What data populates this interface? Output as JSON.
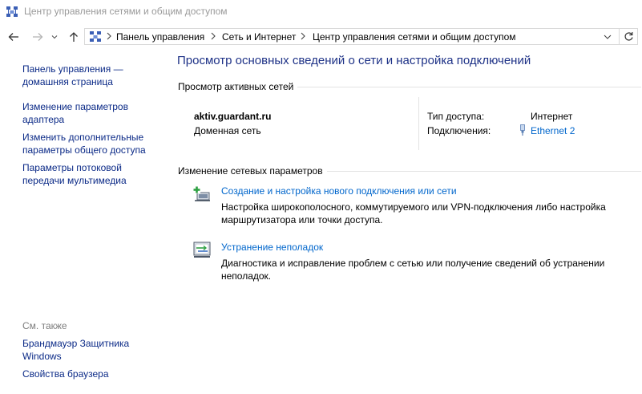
{
  "window": {
    "title": "Центр управления сетями и общим доступом"
  },
  "breadcrumb": {
    "items": [
      "Панель управления",
      "Сеть и Интернет",
      "Центр управления сетями и общим доступом"
    ]
  },
  "sidebar": {
    "links": [
      "Панель управления — домашняя страница",
      "Изменение параметров адаптера",
      "Изменить дополнительные параметры общего доступа",
      "Параметры потоковой передачи мультимедиа"
    ],
    "see_also_label": "См. также",
    "see_also_links": [
      "Брандмауэр Защитника Windows",
      "Свойства браузера"
    ]
  },
  "main": {
    "title": "Просмотр основных сведений о сети и настройка подключений",
    "active_networks": {
      "heading": "Просмотр активных сетей",
      "network_name": "aktiv.guardant.ru",
      "network_type": "Доменная сеть",
      "access_type_label": "Тип доступа:",
      "access_type_value": "Интернет",
      "connections_label": "Подключения:",
      "connections_value": "Ethernet 2"
    },
    "change_settings": {
      "heading": "Изменение сетевых параметров",
      "tasks": [
        {
          "title": "Создание и настройка нового подключения или сети",
          "description": "Настройка широкополосного, коммутируемого или VPN-подключения либо настройка маршрутизатора или точки доступа.",
          "icon": "new-connection-icon"
        },
        {
          "title": "Устранение неполадок",
          "description": "Диагностика и исправление проблем с сетью или получение сведений об устранении неполадок.",
          "icon": "troubleshoot-icon"
        }
      ]
    }
  },
  "icons": {
    "title": "network-center-icon",
    "back": "back-arrow-icon",
    "forward": "forward-arrow-icon",
    "recent": "chevron-down-icon",
    "up": "up-arrow-icon",
    "refresh": "refresh-icon",
    "ethernet": "ethernet-plug-icon"
  },
  "colors": {
    "sidebar_link": "#0b2a87",
    "main_title": "#1e3287",
    "task_link": "#0066cc",
    "muted": "#7d7d7d"
  }
}
